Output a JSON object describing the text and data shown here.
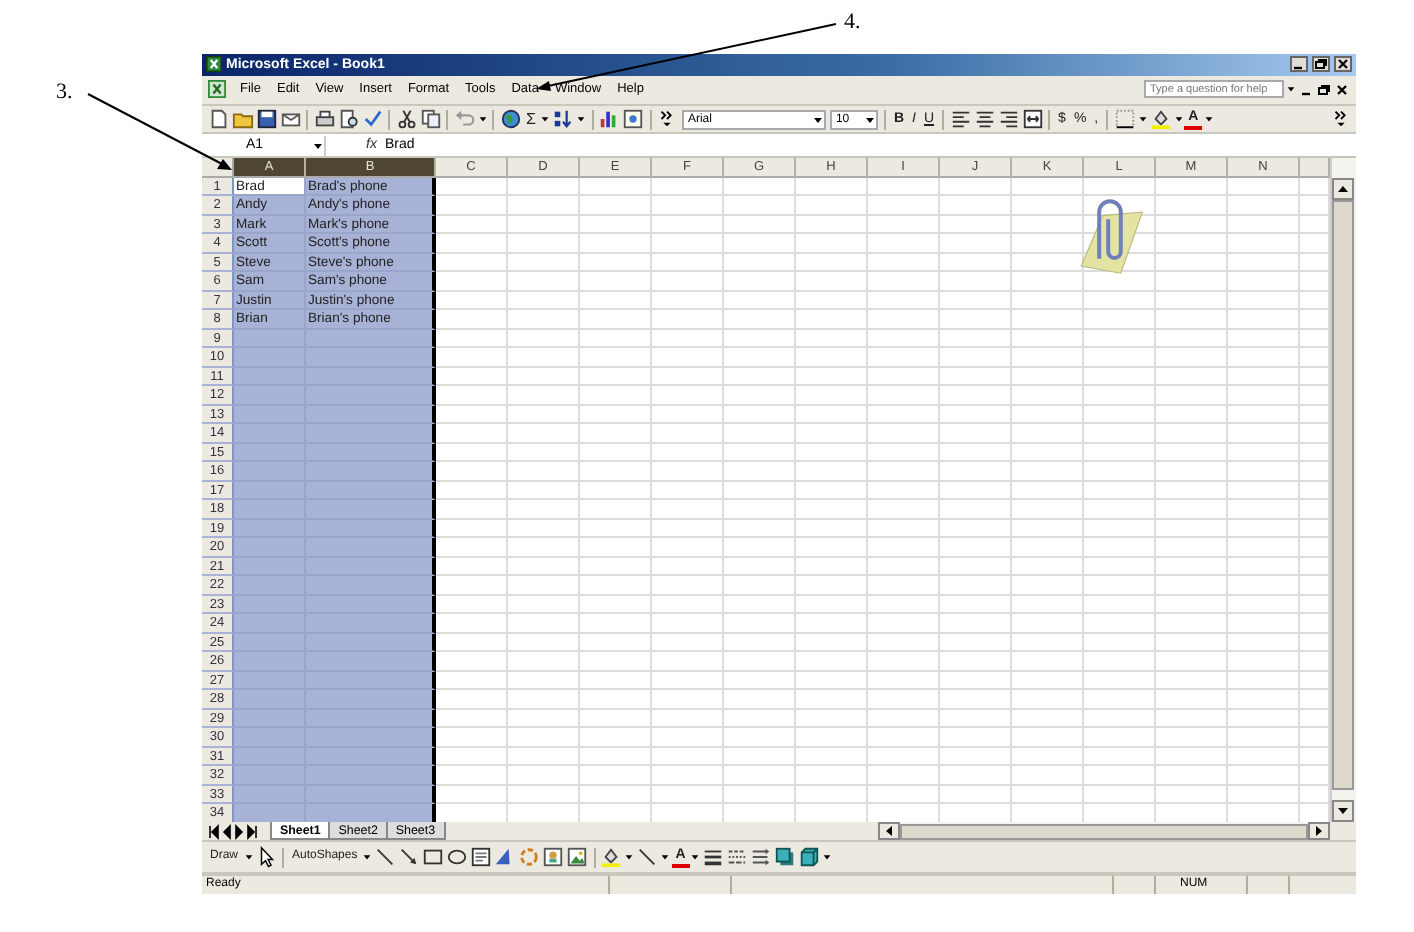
{
  "annotations": [
    {
      "label": "3."
    },
    {
      "label": "4."
    }
  ],
  "window": {
    "title": "Microsoft Excel - Book1"
  },
  "menu": [
    "File",
    "Edit",
    "View",
    "Insert",
    "Format",
    "Tools",
    "Data",
    "Window",
    "Help"
  ],
  "help_box": {
    "placeholder": "Type a question for help"
  },
  "standard_toolbar": {
    "sum": "Σ",
    "font": "Arial",
    "size": "10",
    "bold": "B",
    "italic": "I",
    "underline": "U",
    "currency": "$",
    "percent": "%",
    "comma": ",",
    "font_color": "A"
  },
  "formula_bar": {
    "name_box": "A1",
    "fx": "fx",
    "value": "Brad"
  },
  "columns": [
    {
      "label": "A",
      "selected": true
    },
    {
      "label": "B",
      "selected": true
    },
    {
      "label": "C",
      "selected": false
    },
    {
      "label": "D",
      "selected": false
    },
    {
      "label": "E",
      "selected": false
    },
    {
      "label": "F",
      "selected": false
    },
    {
      "label": "G",
      "selected": false
    },
    {
      "label": "H",
      "selected": false
    },
    {
      "label": "I",
      "selected": false
    },
    {
      "label": "J",
      "selected": false
    },
    {
      "label": "K",
      "selected": false
    },
    {
      "label": "L",
      "selected": false
    },
    {
      "label": "M",
      "selected": false
    },
    {
      "label": "N",
      "selected": false
    }
  ],
  "rows": [
    {
      "number": "1",
      "cells": [
        {
          "text": "Brad",
          "active": true
        },
        {
          "text": "Brad's phone",
          "active": false
        }
      ]
    },
    {
      "number": "2",
      "cells": [
        {
          "text": "Andy",
          "active": false
        },
        {
          "text": "Andy's phone",
          "active": false
        }
      ]
    },
    {
      "number": "3",
      "cells": [
        {
          "text": "Mark",
          "active": false
        },
        {
          "text": "Mark's phone",
          "active": false
        }
      ]
    },
    {
      "number": "4",
      "cells": [
        {
          "text": "Scott",
          "active": false
        },
        {
          "text": "Scott's phone",
          "active": false
        }
      ]
    },
    {
      "number": "5",
      "cells": [
        {
          "text": "Steve",
          "active": false
        },
        {
          "text": "Steve's phone",
          "active": false
        }
      ]
    },
    {
      "number": "6",
      "cells": [
        {
          "text": "Sam",
          "active": false
        },
        {
          "text": "Sam's phone",
          "active": false
        }
      ]
    },
    {
      "number": "7",
      "cells": [
        {
          "text": "Justin",
          "active": false
        },
        {
          "text": "Justin's phone",
          "active": false
        }
      ]
    },
    {
      "number": "8",
      "cells": [
        {
          "text": "Brian",
          "active": false
        },
        {
          "text": "Brian's phone",
          "active": false
        }
      ]
    },
    {
      "number": "9"
    },
    {
      "number": "10"
    },
    {
      "number": "11"
    },
    {
      "number": "12"
    },
    {
      "number": "13"
    },
    {
      "number": "14"
    },
    {
      "number": "15"
    },
    {
      "number": "16"
    },
    {
      "number": "17"
    },
    {
      "number": "18"
    },
    {
      "number": "19"
    },
    {
      "number": "20"
    },
    {
      "number": "21"
    },
    {
      "number": "22"
    },
    {
      "number": "23"
    },
    {
      "number": "24"
    },
    {
      "number": "25"
    },
    {
      "number": "26"
    },
    {
      "number": "27"
    },
    {
      "number": "28"
    },
    {
      "number": "29"
    },
    {
      "number": "30"
    },
    {
      "number": "31"
    },
    {
      "number": "32"
    },
    {
      "number": "33"
    },
    {
      "number": "34"
    }
  ],
  "sheet_tabs": [
    {
      "label": "Sheet1",
      "selected": true
    },
    {
      "label": "Sheet2",
      "selected": false
    },
    {
      "label": "Sheet3",
      "selected": false
    }
  ],
  "drawing_toolbar": {
    "draw": "Draw",
    "autoshapes": "AutoShapes",
    "font_color": "A"
  },
  "status_bar": {
    "mode": "Ready",
    "num": "NUM"
  }
}
